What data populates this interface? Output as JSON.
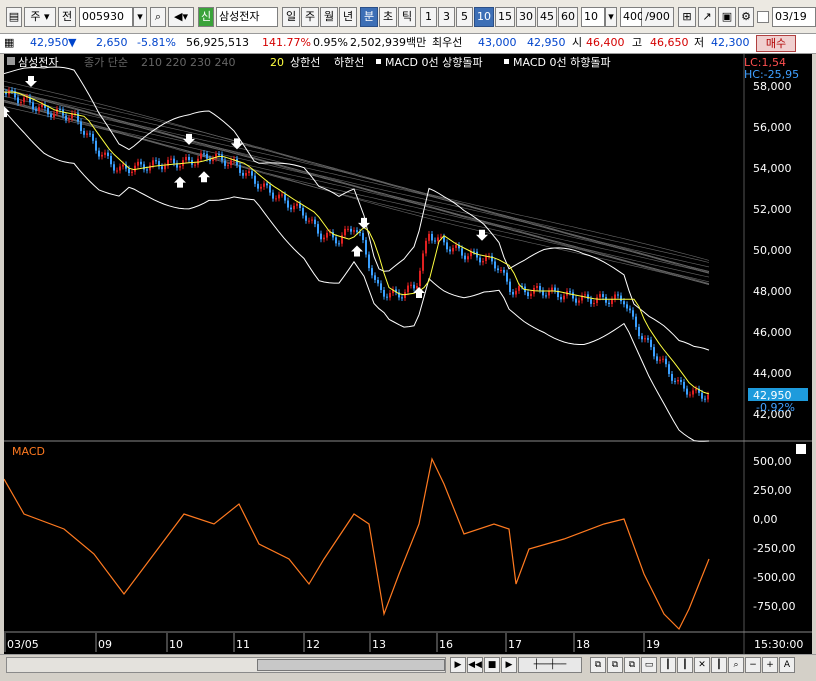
{
  "toolbar": {
    "type_label": "주",
    "jeon_label": "전",
    "code_value": "005930",
    "sin_label": "신",
    "stock_name": "삼성전자",
    "period_buttons": [
      "일",
      "주",
      "월",
      "년",
      "분",
      "초",
      "틱"
    ],
    "interval_buttons": [
      "1",
      "3",
      "5",
      "10",
      "15",
      "30",
      "45",
      "60"
    ],
    "interval_value": "10",
    "count_value": "400",
    "count_total": "/900",
    "date_value": "03/19"
  },
  "quote": {
    "price": "42,950",
    "direction_icon": "▼",
    "change": "2,650",
    "change_pct": "-5.81%",
    "volume": "56,925,513",
    "vol_ratio": "141.77%",
    "turnover_pct": "0.95%",
    "amount": "2,502,939백만",
    "best_label": "최우선",
    "ask": "43,000",
    "bid": "42,950",
    "open_label": "시",
    "open": "46,400",
    "high_label": "고",
    "high": "46,650",
    "low_label": "저",
    "low": "42,300",
    "buy_button": "매수"
  },
  "legend": {
    "stock": "삼성전자",
    "ma_label": "종가 단순",
    "ma_periods": "210 220 230 240",
    "ma_short": "20",
    "upper_band": "상한선",
    "lower_band": "하한선",
    "macd_up": "MACD 0선 상향돌파",
    "macd_down": "MACD 0선 하향돌파",
    "lc": "LC:1,54",
    "hc": "HC:-25,95"
  },
  "price_axis": {
    "ticks": [
      "58,000",
      "56,000",
      "54,000",
      "52,000",
      "50,000",
      "48,000",
      "46,000",
      "44,000",
      "42,000"
    ],
    "current": "42,950",
    "current_pct": "-0.92%"
  },
  "macd": {
    "label": "MACD",
    "ticks": [
      "500,00",
      "250,00",
      "0,00",
      "-250,00",
      "-500,00",
      "-750,00"
    ]
  },
  "time_axis": {
    "ticks": [
      "03/05",
      "09",
      "10",
      "11",
      "12",
      "13",
      "16",
      "17",
      "18",
      "19"
    ],
    "clock": "15:30:00"
  },
  "colors": {
    "background": "#000000",
    "candle_up": "#e02020",
    "candle_down": "#3aa0ff",
    "ma20": "#ffff40",
    "band": "#ffffff",
    "macd_line": "#ff7a20",
    "current_price_box": "#1e9bdc"
  },
  "icons": [
    "chart-type-icon",
    "search-icon",
    "sound-icon",
    "settings-icon",
    "save-icon",
    "zoom-in-icon",
    "zoom-out-icon"
  ]
}
